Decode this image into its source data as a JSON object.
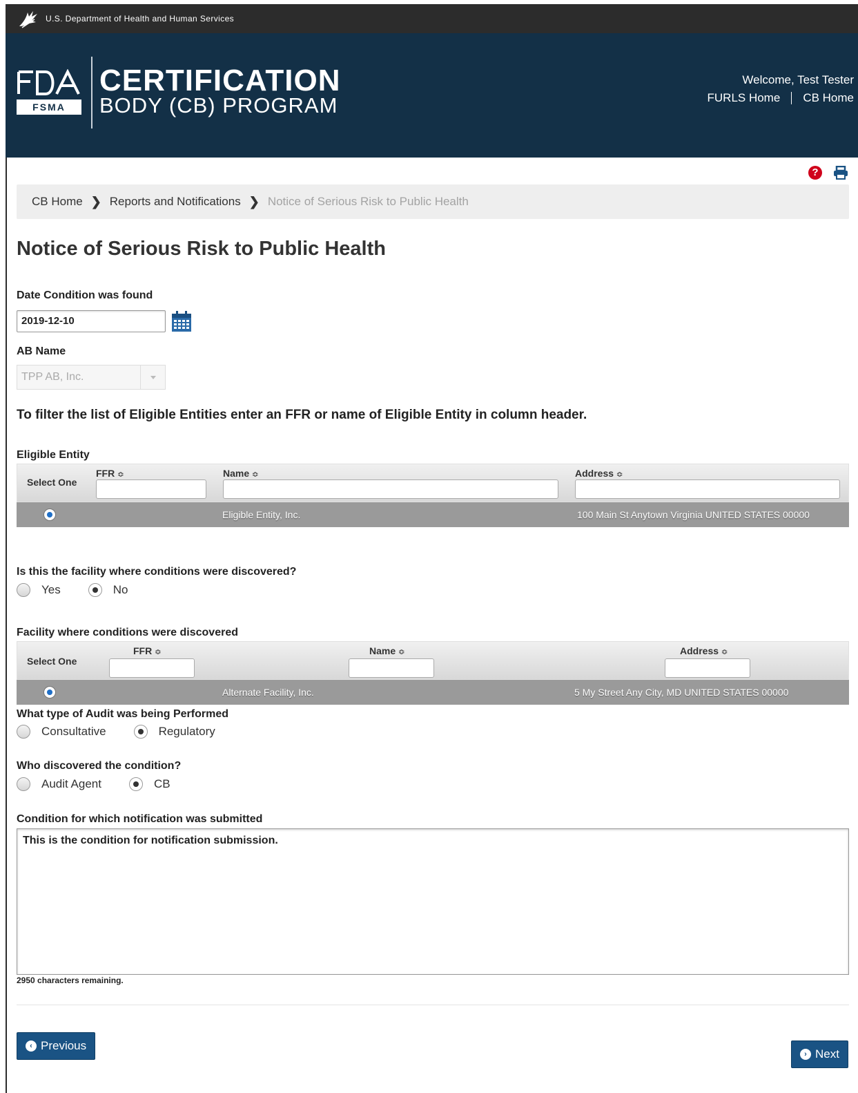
{
  "hhs": {
    "label": "U.S. Department of Health and Human Services"
  },
  "banner": {
    "fsma": "FSMA",
    "title_line1": "CERTIFICATION",
    "title_line2": "BODY (CB) PROGRAM",
    "welcome": "Welcome, Test Tester",
    "links": [
      "FURLS Home",
      "CB Home"
    ]
  },
  "breadcrumb": {
    "items": [
      "CB Home",
      "Reports and Notifications"
    ],
    "current": "Notice of Serious Risk to Public Health"
  },
  "page": {
    "title": "Notice of Serious Risk to Public Health"
  },
  "date_field": {
    "label": "Date Condition was found",
    "value": "2019-12-10"
  },
  "ab_field": {
    "label": "AB Name",
    "value": "TPP AB, Inc."
  },
  "filter_note": "To filter the list of Eligible Entities enter an FFR or name of Eligible Entity in column header.",
  "eligible_table": {
    "label": "Eligible Entity",
    "select_header": "Select One",
    "columns": [
      "FFR",
      "Name",
      "Address"
    ],
    "sort_glyph": "≎",
    "rows": [
      {
        "ffr": "",
        "name": "Eligible Entity, Inc.",
        "address": "100 Main St Anytown Virginia UNITED STATES 00000"
      }
    ]
  },
  "facility_question": {
    "label": "Is this the facility where conditions were discovered?",
    "options": [
      "Yes",
      "No"
    ],
    "selected": "No"
  },
  "facility_table": {
    "label": "Facility where conditions were discovered",
    "select_header": "Select One",
    "columns": [
      "FFR",
      "Name",
      "Address"
    ],
    "sort_glyph": "≎",
    "rows": [
      {
        "ffr": "",
        "name": "Alternate Facility, Inc.",
        "address": "5 My Street Any City, MD UNITED STATES 00000"
      }
    ]
  },
  "audit_type": {
    "label": "What type of Audit was being Performed",
    "options": [
      "Consultative",
      "Regulatory"
    ],
    "selected": "Regulatory"
  },
  "discoverer": {
    "label": "Who discovered the condition?",
    "options": [
      "Audit Agent",
      "CB"
    ],
    "selected": "CB"
  },
  "condition": {
    "label": "Condition for which notification was submitted",
    "value": "This is the condition for notification submission.",
    "remaining": "2950 characters remaining."
  },
  "buttons": {
    "previous": "Previous",
    "next": "Next"
  },
  "colors": {
    "header_bg": "#133047",
    "button_bg": "#1a5384",
    "row_bg": "#9a9a9a",
    "help_icon": "#d0021b"
  }
}
